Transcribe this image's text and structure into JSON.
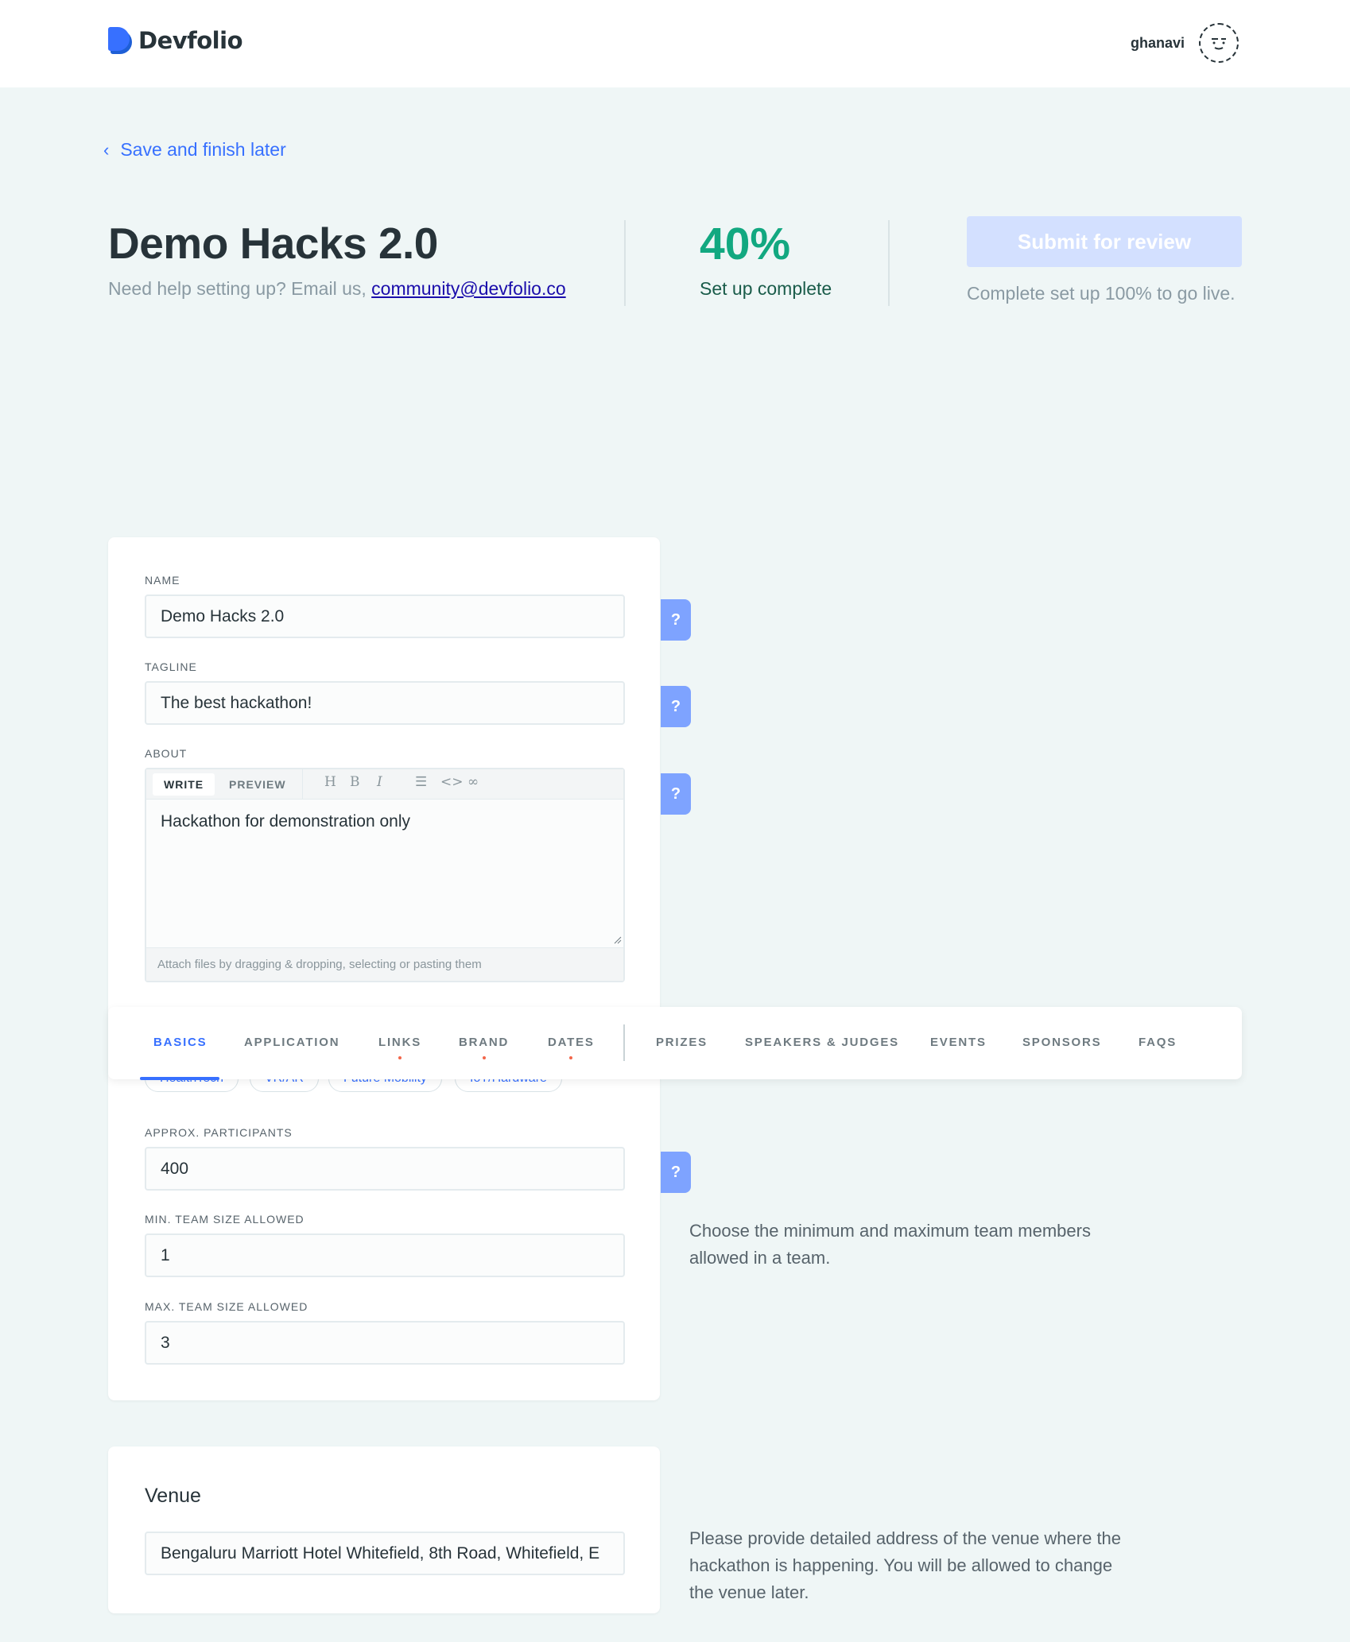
{
  "header": {
    "logo_text": "Devfolio",
    "username": "ghanavi"
  },
  "nav": {
    "back_label": "Save and finish later"
  },
  "summary": {
    "title": "Demo Hacks 2.0",
    "help_prefix": "Need help setting up? Email us, ",
    "help_email": "community@devfolio.co",
    "progress_value": "40%",
    "progress_label": "Set up complete",
    "submit_label": "Submit for review",
    "submit_note": "Complete set up 100% to go live."
  },
  "basics": {
    "name_label": "NAME",
    "name_value": "Demo Hacks 2.0",
    "tagline_label": "TAGLINE",
    "tagline_value": "The best hackathon!",
    "about_label": "ABOUT",
    "editor_tab_write": "WRITE",
    "editor_tab_preview": "PREVIEW",
    "about_value": "Hackathon for demonstration only",
    "editor_footer": "Attach files by dragging & dropping, selecting or pasting them",
    "help_button": "?",
    "themes": [
      "HealthTech",
      "VR/AR",
      "Future Mobility",
      "IoT/Hardware"
    ],
    "participants_label": "APPROX. PARTICIPANTS",
    "participants_value": "400",
    "min_team_label": "MIN. TEAM SIZE ALLOWED",
    "min_team_value": "1",
    "max_team_label": "MAX. TEAM SIZE ALLOWED",
    "max_team_value": "3",
    "team_help": "Choose the minimum and maximum team members allowed in a team."
  },
  "tabs": [
    {
      "label": "BASICS",
      "active": true,
      "incomplete": false
    },
    {
      "label": "APPLICATION",
      "active": false,
      "incomplete": false
    },
    {
      "label": "LINKS",
      "active": false,
      "incomplete": true
    },
    {
      "label": "BRAND",
      "active": false,
      "incomplete": true
    },
    {
      "label": "DATES",
      "active": false,
      "incomplete": true
    },
    {
      "label": "PRIZES",
      "active": false,
      "incomplete": false
    },
    {
      "label": "SPEAKERS & JUDGES",
      "active": false,
      "incomplete": false
    },
    {
      "label": "EVENTS",
      "active": false,
      "incomplete": false
    },
    {
      "label": "SPONSORS",
      "active": false,
      "incomplete": false
    },
    {
      "label": "FAQS",
      "active": false,
      "incomplete": false
    }
  ],
  "venue": {
    "heading": "Venue",
    "value": "Bengaluru Marriott Hotel Whitefield, 8th Road, Whitefield, E",
    "help": "Please provide detailed address of the venue where the hackathon is happening. You will be allowed to change the venue later."
  },
  "colors": {
    "accent": "#3770ff",
    "progress": "#12a880",
    "background": "#eff6f6",
    "incomplete_dot": "#f2664a"
  }
}
